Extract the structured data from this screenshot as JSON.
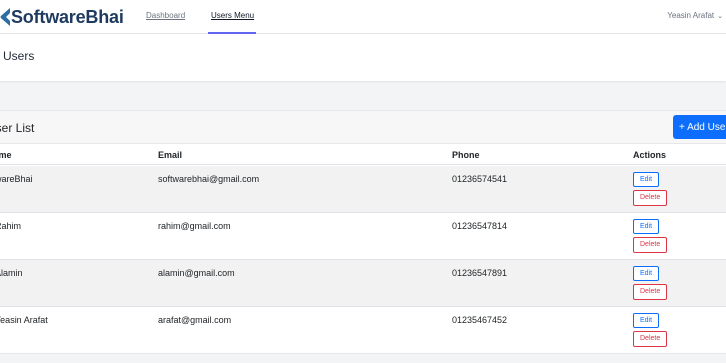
{
  "brand": {
    "name": "SoftwareBhai",
    "mark_color": "#2e6da4"
  },
  "nav": {
    "links": [
      {
        "label": "Dashboard",
        "active": false
      },
      {
        "label": "Users Menu",
        "active": true
      }
    ],
    "user_name": "Yeasin Arafat",
    "accent": "#6366f1"
  },
  "header": {
    "title": "Users"
  },
  "user_list": {
    "title": "User List",
    "add_label": "+ Add User",
    "columns": {
      "name": "Name",
      "email": "Email",
      "phone": "Phone",
      "actions": "Actions"
    },
    "rows": [
      {
        "name": "SoftwareBhai",
        "email": "softwarebhai@gmail.com",
        "phone": "01236574541"
      },
      {
        "name": "Rahim",
        "email": "rahim@gmail.com",
        "phone": "01236547814"
      },
      {
        "name": "Alamin",
        "email": "alamin@gmail.com",
        "phone": "01236547891"
      },
      {
        "name": "Yeasin Arafat",
        "email": "arafat@gmail.com",
        "phone": "01235467452"
      }
    ],
    "edit_label": "Edit",
    "delete_label": "Delete"
  }
}
